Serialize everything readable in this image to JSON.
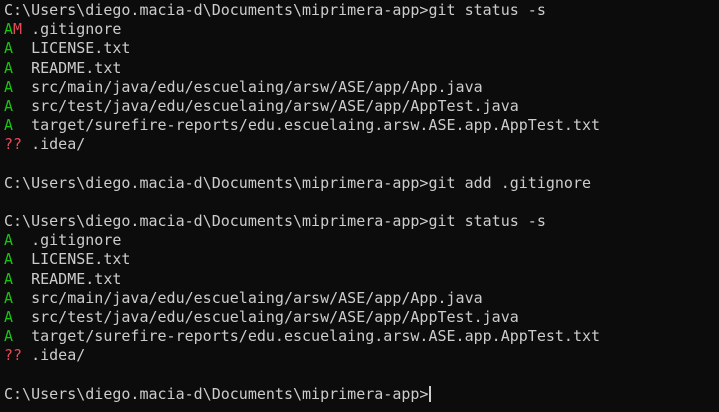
{
  "terminal": {
    "lines": [
      {
        "type": "prompt",
        "prompt": "C:\\Users\\diego.macia-d\\Documents\\miprimera-app>",
        "command": "git status -s"
      },
      {
        "type": "status",
        "code": "AM",
        "path": ".gitignore"
      },
      {
        "type": "status",
        "code": "A",
        "path": "LICENSE.txt"
      },
      {
        "type": "status",
        "code": "A",
        "path": "README.txt"
      },
      {
        "type": "status",
        "code": "A",
        "path": "src/main/java/edu/escuelaing/arsw/ASE/app/App.java"
      },
      {
        "type": "status",
        "code": "A",
        "path": "src/test/java/edu/escuelaing/arsw/ASE/app/AppTest.java"
      },
      {
        "type": "status",
        "code": "A",
        "path": "target/surefire-reports/edu.escuelaing.arsw.ASE.app.AppTest.txt"
      },
      {
        "type": "status",
        "code": "??",
        "path": ".idea/"
      },
      {
        "type": "blank"
      },
      {
        "type": "prompt",
        "prompt": "C:\\Users\\diego.macia-d\\Documents\\miprimera-app>",
        "command": "git add .gitignore"
      },
      {
        "type": "blank"
      },
      {
        "type": "prompt",
        "prompt": "C:\\Users\\diego.macia-d\\Documents\\miprimera-app>",
        "command": "git status -s"
      },
      {
        "type": "status",
        "code": "A",
        "path": ".gitignore"
      },
      {
        "type": "status",
        "code": "A",
        "path": "LICENSE.txt"
      },
      {
        "type": "status",
        "code": "A",
        "path": "README.txt"
      },
      {
        "type": "status",
        "code": "A",
        "path": "src/main/java/edu/escuelaing/arsw/ASE/app/App.java"
      },
      {
        "type": "status",
        "code": "A",
        "path": "src/test/java/edu/escuelaing/arsw/ASE/app/AppTest.java"
      },
      {
        "type": "status",
        "code": "A",
        "path": "target/surefire-reports/edu.escuelaing.arsw.ASE.app.AppTest.txt"
      },
      {
        "type": "status",
        "code": "??",
        "path": ".idea/"
      },
      {
        "type": "blank"
      },
      {
        "type": "prompt",
        "prompt": "C:\\Users\\diego.macia-d\\Documents\\miprimera-app>",
        "command": "",
        "cursor": true
      }
    ]
  },
  "colors": {
    "background": "#0c0c0c",
    "text": "#cccccc",
    "staged": "#16c60c",
    "unstaged": "#e74856"
  }
}
